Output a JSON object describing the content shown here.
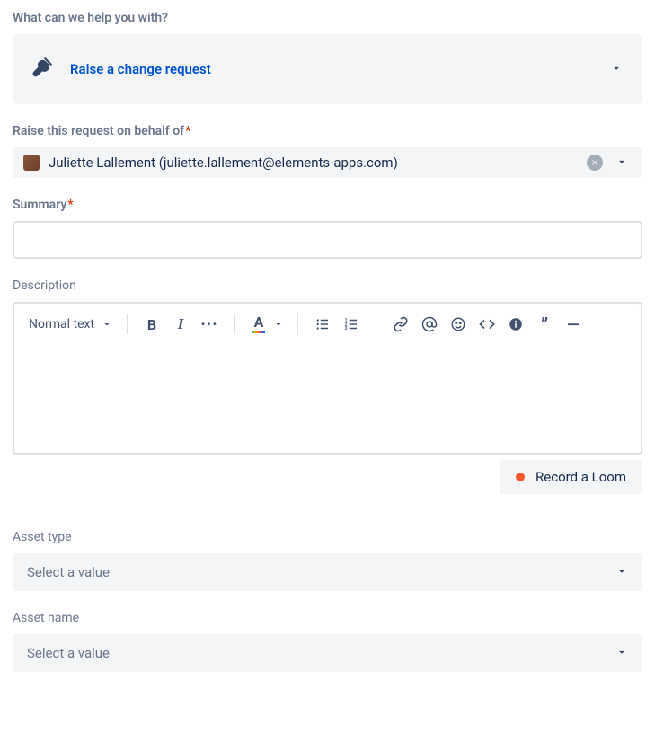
{
  "header": {
    "question": "What can we help you with?",
    "requestType": "Raise a change request"
  },
  "behalfOf": {
    "label": "Raise this request on behalf of",
    "user": "Juliette Lallement (juliette.lallement@elements-apps.com)"
  },
  "summary": {
    "label": "Summary",
    "value": ""
  },
  "description": {
    "label": "Description",
    "textStyle": "Normal text",
    "value": ""
  },
  "loom": {
    "label": "Record a Loom"
  },
  "assetType": {
    "label": "Asset type",
    "placeholder": "Select a value"
  },
  "assetName": {
    "label": "Asset name",
    "placeholder": "Select a value"
  }
}
